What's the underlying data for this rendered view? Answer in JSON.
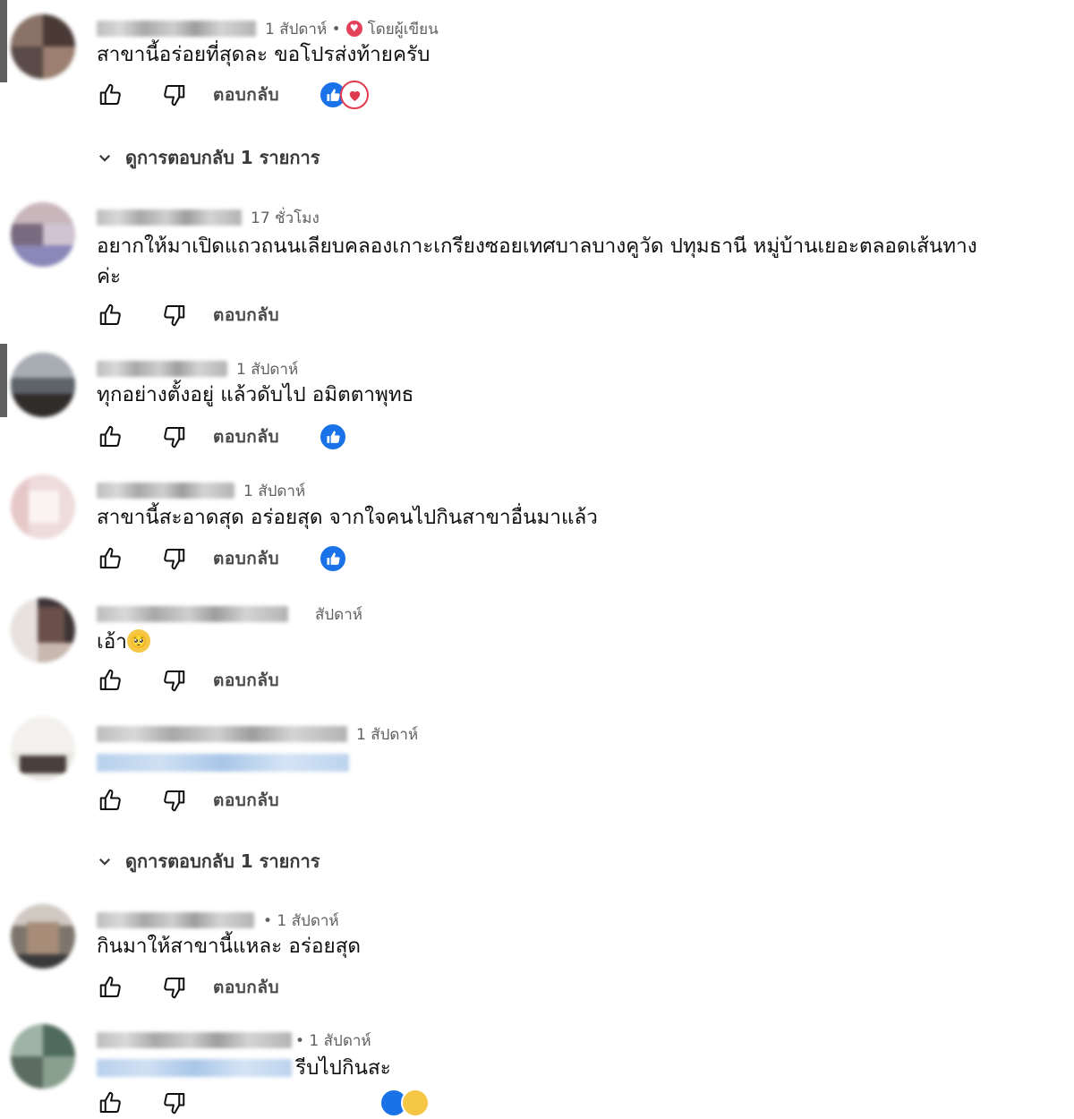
{
  "reply_label": "ตอบกลับ",
  "view_replies_label": "ดูการตอบกลับ 1 รายการ",
  "author_badge_label": "โดยผู้เขียน",
  "comments": [
    {
      "time": "1 สัปดาห์ •",
      "text": "สาขานี้อร่อยที่สุดละ ขอโปรส่งท้ายครับ"
    },
    {
      "time": "17 ชั่วโมง",
      "text": "อยากให้มาเปิดแถวถนนเลียบคลองเกาะเกรียงซอยเทศบาลบางคูวัด ปทุมธานี หมู่บ้านเยอะตลอดเส้นทางค่ะ"
    },
    {
      "time": "1 สัปดาห์",
      "text": "ทุกอย่างตั้งอยู่ แล้วดับไป อมิตตาพุทธ"
    },
    {
      "time": "1 สัปดาห์",
      "text": "สาขานี้สะอาดสุด อร่อยสุด จากใจคนไปกินสาขาอื่นมาแล้ว"
    },
    {
      "time": "สัปดาห์",
      "text": "เอ้า"
    },
    {
      "time": "1 สัปดาห์",
      "text": ""
    },
    {
      "time": "• 1 สัปดาห์",
      "text": "กินมาให้สาขานี้แหละ อร่อยสุด"
    },
    {
      "time": "• 1 สัปดาห์",
      "text": "รีบไปกินสะ"
    }
  ],
  "icons": {
    "like": "thumbs-up-icon",
    "dislike": "thumbs-down-icon",
    "chevron": "chevron-down-icon",
    "heart_badge": "heart-icon"
  },
  "colors": {
    "like_reaction": "#1a72e8",
    "heart_reaction": "#e03a4f",
    "author_heart": "#e3425a",
    "meta_text": "#606060"
  }
}
